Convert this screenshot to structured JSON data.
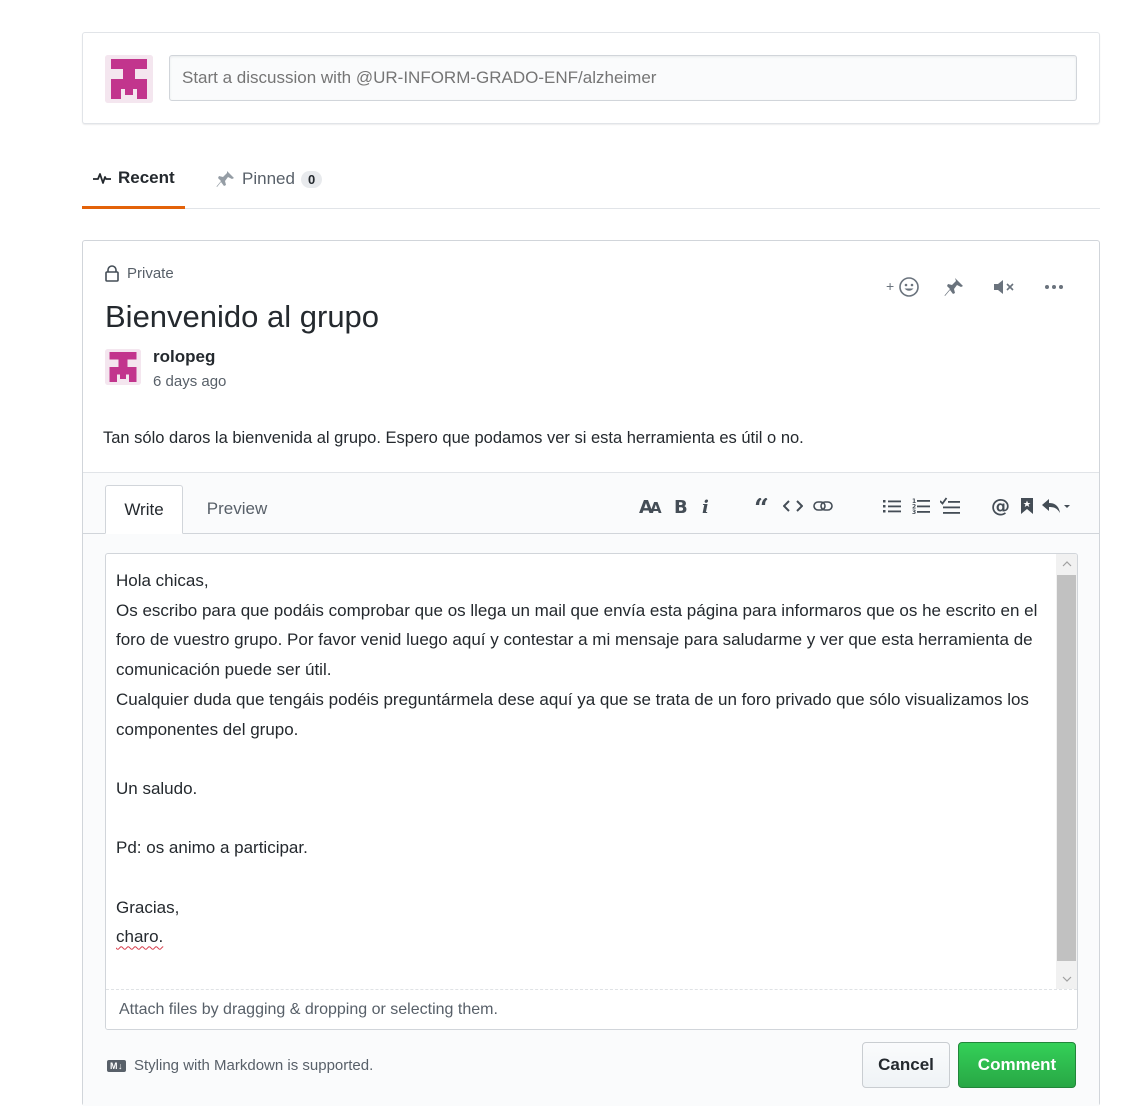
{
  "composer": {
    "placeholder": "Start a discussion with @UR-INFORM-GRADO-ENF/alzheimer"
  },
  "tabs": {
    "recent_label": "Recent",
    "pinned_label": "Pinned",
    "pinned_count": "0"
  },
  "discussion": {
    "visibility": "Private",
    "title": "Bienvenido al grupo",
    "author": "rolopeg",
    "time": "6 days ago",
    "body": "Tan sólo daros la bienvenida al grupo. Espero que podamos ver si esta herramienta es útil o no."
  },
  "editor": {
    "write_tab": "Write",
    "preview_tab": "Preview",
    "text_main": "Hola chicas,\nOs escribo para que podáis comprobar que os llega un mail que envía esta página para informaros que os he escrito en el foro de vuestro grupo. Por favor venid luego aquí y contestar a mi mensaje para saludarme y ver que esta herramienta de comunicación puede ser útil.\nCualquier duda que tengáis podéis preguntármela dese aquí ya que se trata de un foro privado que sólo visualizamos los componentes del grupo.\n\nUn saludo.\n\nPd: os animo a participar.\n\nGracias,\n",
    "text_signature": "charo.",
    "attach_hint": "Attach files by dragging & dropping or selecting them.",
    "markdown_badge": "M↓",
    "markdown_note": "Styling with Markdown is supported.",
    "cancel_label": "Cancel",
    "comment_label": "Comment"
  },
  "colors": {
    "accent_tab": "#e36209",
    "avatar": "#c2358d",
    "comment_button": "#28a745"
  },
  "icons": [
    "pulse-icon",
    "pin-icon",
    "lock-icon",
    "add-reaction-icon",
    "mute-icon",
    "kebab-icon",
    "text-size-icon",
    "bold-icon",
    "italic-icon",
    "quote-icon",
    "code-icon",
    "link-icon",
    "unordered-list-icon",
    "ordered-list-icon",
    "task-list-icon",
    "mention-icon",
    "bookmark-icon",
    "reply-icon",
    "markdown-icon"
  ]
}
